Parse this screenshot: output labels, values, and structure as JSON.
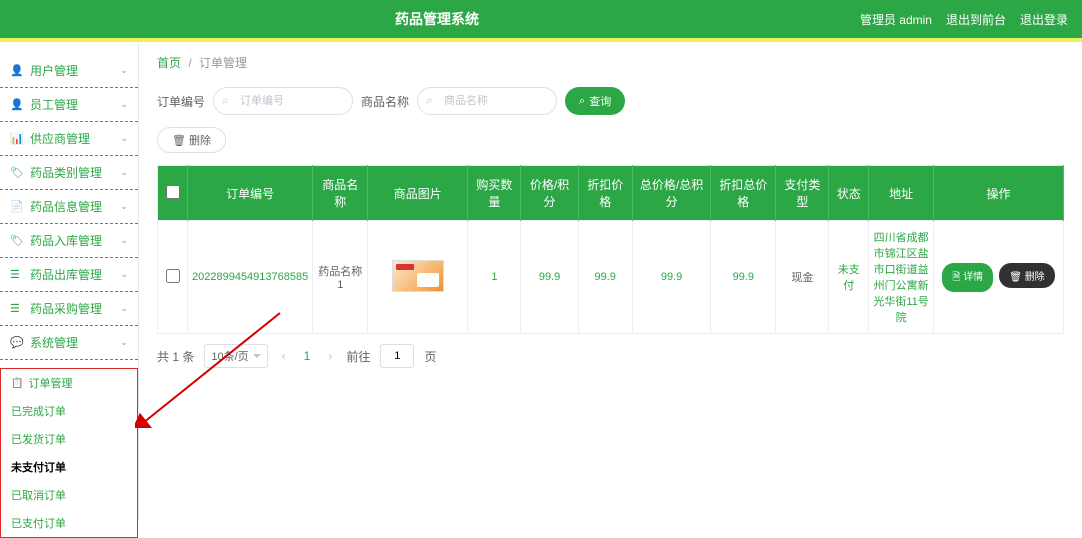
{
  "header": {
    "title": "药品管理系统",
    "admin_label": "管理员 admin",
    "to_front": "退出到前台",
    "logout": "退出登录"
  },
  "sidebar": {
    "items": [
      {
        "icon": "👤",
        "label": "用户管理"
      },
      {
        "icon": "👤",
        "label": "员工管理"
      },
      {
        "icon": "📊",
        "label": "供应商管理"
      },
      {
        "icon": "🏷",
        "label": "药品类别管理"
      },
      {
        "icon": "📄",
        "label": "药品信息管理"
      },
      {
        "icon": "🏷",
        "label": "药品入库管理"
      },
      {
        "icon": "☰",
        "label": "药品出库管理"
      },
      {
        "icon": "☰",
        "label": "药品采购管理"
      },
      {
        "icon": "💬",
        "label": "系统管理"
      }
    ],
    "sub": [
      {
        "label": "订单管理",
        "icon": "📋"
      },
      {
        "label": "已完成订单"
      },
      {
        "label": "已发货订单"
      },
      {
        "label": "未支付订单",
        "active": true
      },
      {
        "label": "已取消订单"
      },
      {
        "label": "已支付订单"
      }
    ]
  },
  "crumb": {
    "home": "首页",
    "sep": "/",
    "cur": "订单管理"
  },
  "search": {
    "label1": "订单编号",
    "ph1": "订单编号",
    "label2": "商品名称",
    "ph2": "商品名称",
    "btn": "查询",
    "del": "删除"
  },
  "table": {
    "headers": [
      "",
      "订单编号",
      "商品名称",
      "商品图片",
      "购买数量",
      "价格/积分",
      "折扣价格",
      "总价格/总积分",
      "折扣总价格",
      "支付类型",
      "状态",
      "地址",
      "操作"
    ],
    "row": {
      "order_no": "2022899454913768585",
      "product": "药品名称1",
      "qty": "1",
      "price": "99.9",
      "discount": "99.9",
      "total": "99.9",
      "discount_total": "99.9",
      "pay_type": "现金",
      "status": "未支付",
      "address": "四川省成都市锦江区盐市口街道益州门公寓新光华街11号院",
      "edit": "详情",
      "del": "删除"
    }
  },
  "pager": {
    "total": "共 1 条",
    "size": "10条/页",
    "page": "1",
    "goto": "前往",
    "goto_val": "1",
    "unit": "页"
  }
}
